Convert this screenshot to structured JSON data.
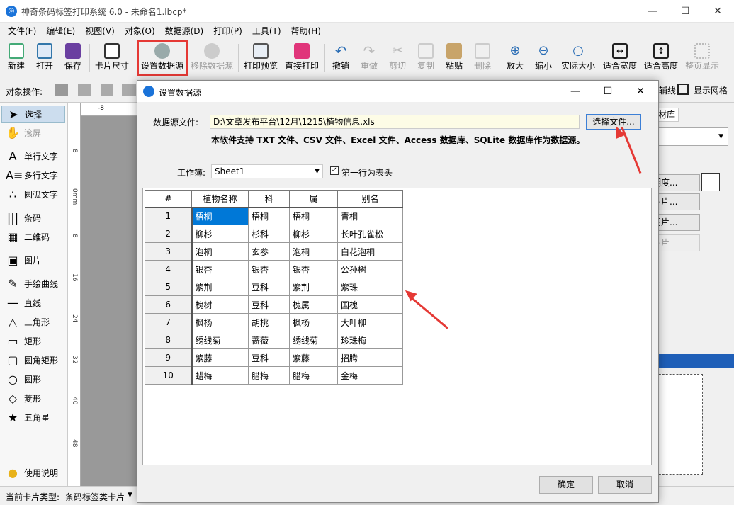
{
  "window": {
    "title": "神奇条码标签打印系统 6.0 - 未命名1.lbcp*",
    "minimize": "—",
    "maximize": "☐",
    "close": "✕"
  },
  "menu": [
    "文件(F)",
    "编辑(E)",
    "视图(V)",
    "对象(O)",
    "数据源(D)",
    "打印(P)",
    "工具(T)",
    "帮助(H)"
  ],
  "toolbar": {
    "new": "新建",
    "open": "打开",
    "save": "保存",
    "card_size": "卡片尺寸",
    "set_datasource": "设置数据源",
    "remove_datasource": "移除数据源",
    "print_preview": "打印预览",
    "direct_print": "直接打印",
    "undo": "撤销",
    "redo": "重做",
    "cut": "剪切",
    "copy": "复制",
    "paste": "粘贴",
    "delete": "删除",
    "zoom_in": "放大",
    "zoom_out": "缩小",
    "actual_size": "实际大小",
    "fit_width": "适合宽度",
    "fit_height": "适合高度",
    "fit_page": "整页显示"
  },
  "ops": {
    "label": "对象操作:",
    "guide": "辅线",
    "show_grid": "显示网格"
  },
  "left_panel": [
    "选择",
    "滚屏",
    "单行文字",
    "多行文字",
    "圆弧文字",
    "条码",
    "二维码",
    "图片",
    "手绘曲线",
    "直线",
    "三角形",
    "矩形",
    "圆角矩形",
    "圆形",
    "菱形",
    "五角星",
    "使用说明"
  ],
  "ruler": [
    "-8",
    "8",
    "0mm",
    "8",
    "16",
    "24",
    "32",
    "40",
    "48"
  ],
  "right_panel": {
    "tab": "材库",
    "brightness": "明度...",
    "picture1": "图片...",
    "picture2": "图片...",
    "picture3": "图片"
  },
  "status": {
    "label": "当前卡片类型:",
    "value": "条码标签类卡片"
  },
  "dialog": {
    "title": "设置数据源",
    "ds_label": "数据源文件:",
    "ds_path": "D:\\文章发布平台\\12月\\1215\\植物信息.xls",
    "choose_button": "选择文件...",
    "support_text": "本软件支持 TXT 文件、CSV 文件、Excel 文件、Access 数据库、SQLite 数据库作为数据源。",
    "workbook_label": "工作簿:",
    "workbook_value": "Sheet1",
    "first_row_header_label": "第一行为表头",
    "first_row_header_checked": true,
    "ok": "确定",
    "cancel": "取消",
    "table": {
      "headers": [
        "#",
        "植物名称",
        "科",
        "属",
        "别名"
      ],
      "rows": [
        [
          "1",
          "梧桐",
          "梧桐",
          "梧桐",
          "青桐"
        ],
        [
          "2",
          "柳杉",
          "杉科",
          "柳杉",
          "长叶孔雀松"
        ],
        [
          "3",
          "泡桐",
          "玄参",
          "泡桐",
          "白花泡桐"
        ],
        [
          "4",
          "银杏",
          "银杏",
          "银杏",
          "公孙树"
        ],
        [
          "5",
          "紫荆",
          "豆科",
          "紫荆",
          "紫珠"
        ],
        [
          "6",
          "槐树",
          "豆科",
          "槐属",
          "国槐"
        ],
        [
          "7",
          "枫杨",
          "胡桃",
          "枫杨",
          "大叶柳"
        ],
        [
          "8",
          "绣线菊",
          "蔷薇",
          "绣线菊",
          "珍珠梅"
        ],
        [
          "9",
          "紫藤",
          "豆科",
          "紫藤",
          "招腾"
        ],
        [
          "10",
          "蜡梅",
          "腊梅",
          "腊梅",
          "金梅"
        ]
      ]
    }
  },
  "colors": {
    "accent": "#0078d7",
    "annotation": "#e53935",
    "input_bg": "#fdfce6"
  }
}
